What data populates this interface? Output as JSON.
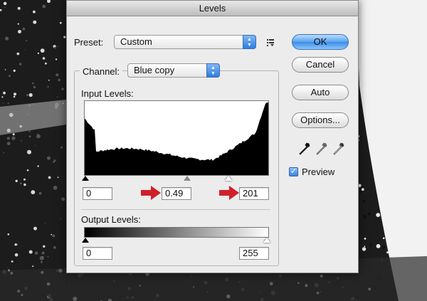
{
  "window": {
    "title": "Levels"
  },
  "preset": {
    "label": "Preset:",
    "value": "Custom"
  },
  "channel": {
    "label": "Channel:",
    "value": "Blue copy"
  },
  "input_levels": {
    "label": "Input Levels:",
    "black": "0",
    "gamma": "0.49",
    "white": "201"
  },
  "output_levels": {
    "label": "Output Levels:",
    "black": "0",
    "white": "255"
  },
  "buttons": {
    "ok": "OK",
    "cancel": "Cancel",
    "auto": "Auto",
    "options": "Options..."
  },
  "preview": {
    "label": "Preview",
    "checked": true
  },
  "colors": {
    "accent": "#3a8ee8",
    "arrow": "#d0202a"
  },
  "icons": {
    "preset_menu": "preset-options-icon",
    "eyedroppers": [
      "black-eyedropper-icon",
      "gray-eyedropper-icon",
      "white-eyedropper-icon"
    ]
  }
}
